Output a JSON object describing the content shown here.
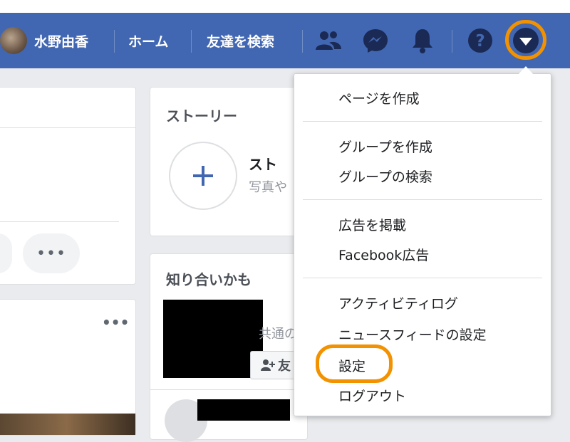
{
  "topbar": {
    "user_name": "水野由香",
    "home_label": "ホーム",
    "find_friends_label": "友達を検索",
    "icons": [
      "friends-icon",
      "messenger-icon",
      "bell-icon",
      "help-icon",
      "chevron-down-icon"
    ]
  },
  "stories": {
    "title": "ストーリー",
    "create_title_partial": "スト",
    "create_sub_partial": "写真や"
  },
  "people_you_may_know": {
    "title": "知り合いかも",
    "mutual_partial": "共通の",
    "add_friend_partial": "友"
  },
  "dropdown_menu": {
    "sections": [
      [
        "ページを作成"
      ],
      [
        "グループを作成",
        "グループの検索"
      ],
      [
        "広告を掲載",
        "Facebook広告"
      ],
      [
        "アクティビティログ",
        "ニュースフィードの設定",
        "設定",
        "ログアウト"
      ]
    ]
  },
  "colors": {
    "brand_blue": "#4267b2",
    "highlight_orange": "#f39200",
    "page_bg": "#e9ebee"
  }
}
